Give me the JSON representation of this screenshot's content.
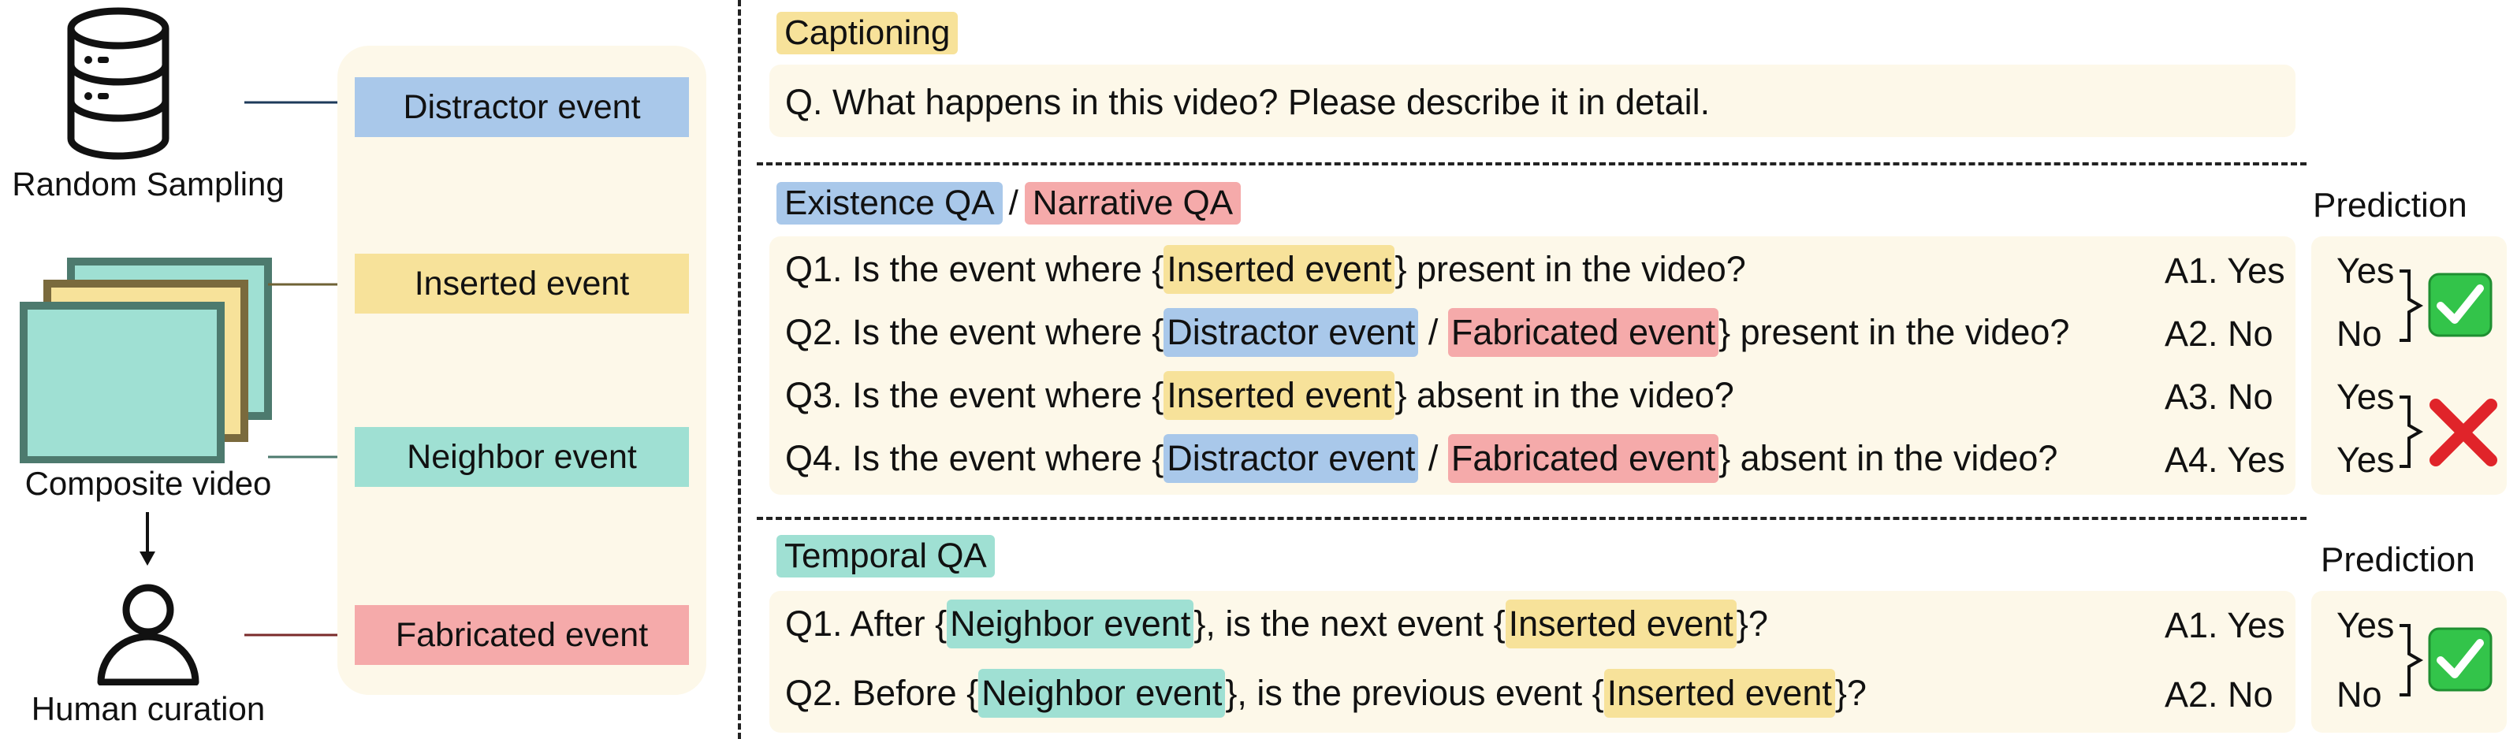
{
  "left": {
    "random_sampling": "Random Sampling",
    "composite_video": "Composite video",
    "human_curation": "Human curation",
    "events": [
      {
        "label": "Distractor event",
        "color": "#a9c8ea"
      },
      {
        "label": "Inserted event",
        "color": "#f7e29a"
      },
      {
        "label": "Neighbor event",
        "color": "#9fe0d3"
      },
      {
        "label": "Fabricated event",
        "color": "#f5aaaa"
      }
    ]
  },
  "captioning": {
    "title": "Captioning",
    "question": "Q. What happens in this video? Please describe it in detail."
  },
  "existence": {
    "title_a": "Existence QA",
    "slash": "/",
    "title_b": "Narrative QA",
    "prediction_title": "Prediction",
    "q1": {
      "pre": "Q1. Is the event where {",
      "tag": "Inserted event",
      "post": "} present in the video?",
      "answer": "A1. Yes",
      "pred": "Yes"
    },
    "q2": {
      "pre": "Q2. Is the event where {",
      "tag1": "Distractor event",
      "sep": " / ",
      "tag2": "Fabricated event",
      "post": "} present in the video?",
      "answer": "A2. No",
      "pred": "No"
    },
    "q3": {
      "pre": "Q3. Is the event where {",
      "tag": "Inserted event",
      "post": "} absent in the video?",
      "answer": "A3. No",
      "pred": "Yes"
    },
    "q4": {
      "pre": "Q4. Is the event where {",
      "tag1": "Distractor event",
      "sep": " / ",
      "tag2": "Fabricated event",
      "post": "} absent in the video?",
      "answer": "A4. Yes",
      "pred": "Yes"
    }
  },
  "temporal": {
    "title": "Temporal QA",
    "prediction_title": "Prediction",
    "q1": {
      "pre": "Q1. After {",
      "tag1": "Neighbor event",
      "mid": "}, is the next event {",
      "tag2": "Inserted event",
      "post": "}?",
      "answer": "A1. Yes",
      "pred": "Yes"
    },
    "q2": {
      "pre": "Q2. Before {",
      "tag1": "Neighbor event",
      "mid": "}, is the previous event {",
      "tag2": "Inserted event",
      "post": "}?",
      "answer": "A2. No",
      "pred": "No"
    }
  }
}
